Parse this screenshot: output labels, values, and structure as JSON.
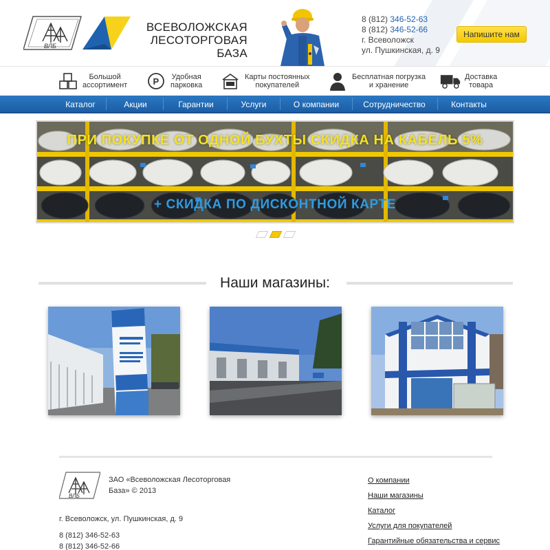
{
  "header": {
    "company_name_line1": "Всеволожская",
    "company_name_line2": "лесоторговая база",
    "logo_text": "ВЛБ",
    "phone1_prefix": "8 (812) ",
    "phone1": "346-52-63",
    "phone2_prefix": "8 (812) ",
    "phone2": "346-52-66",
    "city": "г. Всеволожск",
    "street": "ул. Пушкинская, д. 9",
    "write_button": "Напишите нам"
  },
  "features": [
    {
      "icon": "boxes-icon",
      "line1": "Большой",
      "line2": "ассортимент"
    },
    {
      "icon": "parking-icon",
      "line1": "Удобная",
      "line2": "парковка"
    },
    {
      "icon": "card-icon",
      "line1": "Карты постоянных",
      "line2": "покупателей"
    },
    {
      "icon": "worker-icon",
      "line1": "Бесплатная погрузка",
      "line2": "и хранение"
    },
    {
      "icon": "truck-icon",
      "line1": "Доставка",
      "line2": "товара"
    }
  ],
  "nav": [
    "Каталог",
    "Акции",
    "Гарантии",
    "Услуги",
    "О компании",
    "Сотрудничество",
    "Контакты"
  ],
  "banner": {
    "title": "ПРИ ПОКУПКЕ ОТ ОДНОЙ БУХТЫ СКИДКА НА КАБЕЛЬ 5%",
    "subtitle": "+ СКИДКА ПО ДИСКОНТНОЙ КАРТЕ",
    "active_slide": 2,
    "slide_count": 3
  },
  "shops": {
    "title": "Наши магазины:"
  },
  "footer": {
    "company_line1": "ЗАО «Всеволожская Лесоторговая",
    "company_line2": "База» © 2013",
    "address": "г. Всеволожск, ул. Пушкинская, д. 9",
    "phone1": "8 (812) 346-52-63",
    "phone2": "8 (812) 346-52-66",
    "links": [
      "О компании",
      "Наши магазины",
      "Каталог",
      "Услуги для покупателей",
      "Гарантийные обязательства и сервис"
    ]
  },
  "colors": {
    "accent_blue": "#1b5ea6",
    "accent_yellow": "#f5c800",
    "banner_title": "#f6e21c",
    "banner_subtitle": "#2f9be0"
  }
}
